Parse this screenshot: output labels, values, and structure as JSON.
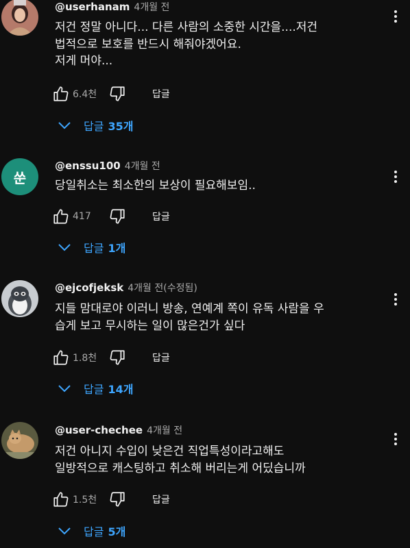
{
  "comments": [
    {
      "handle": "@userhanam",
      "time": "4개월 전",
      "text": "저건 정말 아니다... 다른 사람의 소중한 시간을....저건\n법적으로 보호를 반드시 해줘야겠어요.\n저게 머야...",
      "likes": "6.4천",
      "reply_label": "답글",
      "replies_word": "답글",
      "replies_count": "35개"
    },
    {
      "handle": "@enssu100",
      "time": "4개월 전",
      "avatar_letter": "쑨",
      "text": "당일취소는 최소한의 보상이 필요해보임..",
      "likes": "417",
      "reply_label": "답글",
      "replies_word": "답글",
      "replies_count": "1개"
    },
    {
      "handle": "@ejcofjeksk",
      "time": "4개월 전(수정됨)",
      "text": "지들 맘대로야 이러니 방송, 연예계 쪽이 유독 사람을 우\n습게 보고 무시하는 일이 많은건가 싶다",
      "likes": "1.8천",
      "reply_label": "답글",
      "replies_word": "답글",
      "replies_count": "14개"
    },
    {
      "handle": "@user-chechee",
      "time": "4개월 전",
      "text": "저건 아니지 수입이 낮은건 직업특성이라고해도\n일방적으로 캐스팅하고 취소해 버리는게 어딨습니까",
      "likes": "1.5천",
      "reply_label": "답글",
      "replies_word": "답글",
      "replies_count": "5개"
    }
  ],
  "colors": {
    "background": "#0f0f0f",
    "link": "#3ea6ff",
    "secondary_text": "#aaaaaa"
  },
  "icons": [
    "thumb-up-icon",
    "thumb-down-icon",
    "more-vert-icon",
    "chevron-down-icon"
  ]
}
